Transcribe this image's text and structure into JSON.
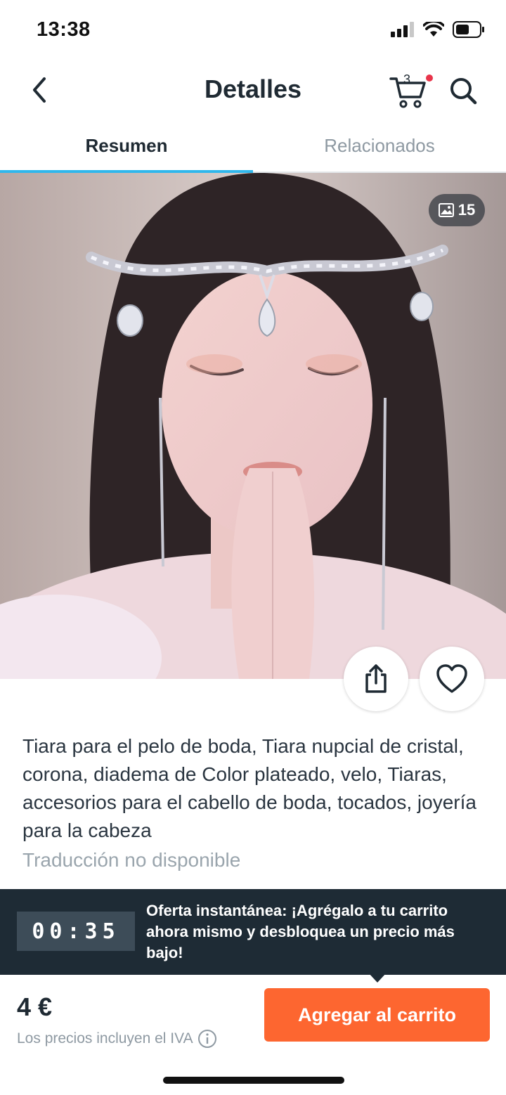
{
  "status_bar": {
    "time": "13:38"
  },
  "header": {
    "title": "Detalles",
    "cart_count": "3"
  },
  "tabs": [
    {
      "label": "Resumen",
      "active": true
    },
    {
      "label": "Relacionados",
      "active": false
    }
  ],
  "product": {
    "photo_count": "15",
    "title": "Tiara para el pelo de boda, Tiara nupcial de cristal, corona, diadema de Color plateado, velo, Tiaras, accesorios para el cabello de boda, tocados, joyería para la cabeza",
    "translation_note": "Traducción no disponible"
  },
  "offer": {
    "timer": "00:35",
    "text": "Oferta instantánea: ¡Agrégalo a tu carrito ahora mismo y desbloquea un precio más bajo!"
  },
  "purchase": {
    "price": "4 €",
    "tax_note": "Los precios incluyen el IVA",
    "add_to_cart_label": "Agregar al carrito"
  },
  "icons": [
    "back-chevron-icon",
    "cart-icon",
    "search-icon",
    "image-icon",
    "share-icon",
    "heart-icon",
    "info-icon"
  ],
  "colors": {
    "accent_tab": "#2fb7ec",
    "cart_button": "#fd6630",
    "offer_bar": "#1e2b35",
    "notification_dot": "#e8344a"
  }
}
